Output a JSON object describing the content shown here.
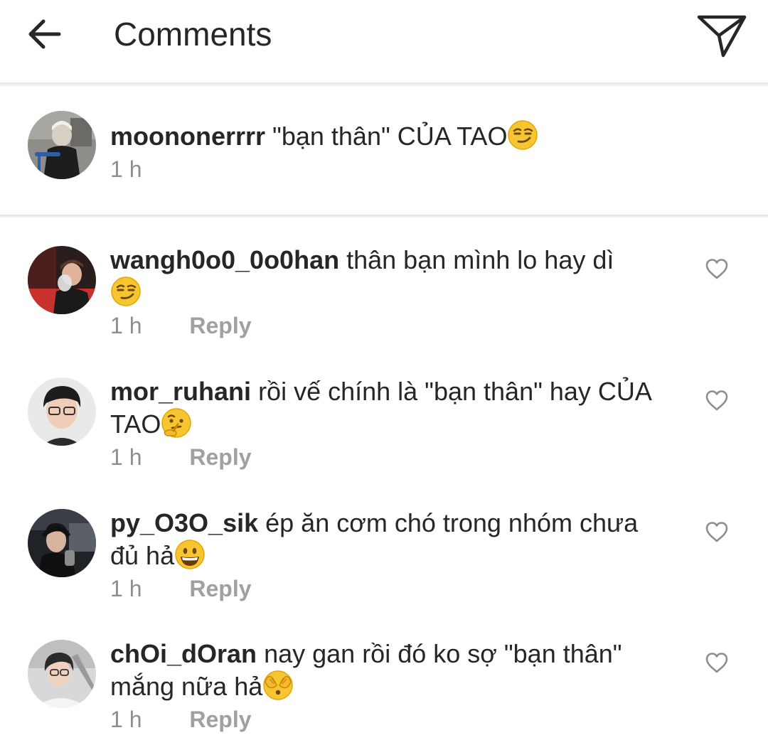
{
  "header": {
    "title": "Comments",
    "back_icon": "arrow-left-icon",
    "send_icon": "paper-plane-icon"
  },
  "caption": {
    "username": "moononerrrr",
    "text": "\"bạn thân\" CỦA TAO",
    "emoji": "smirk-emoji",
    "time": "1 h"
  },
  "comments": [
    {
      "username": "wangh0o0_0o0han",
      "text": "thân bạn mình lo hay dì",
      "emoji": "smirk-emoji",
      "time": "1 h",
      "reply_label": "Reply"
    },
    {
      "username": "mor_ruhani",
      "text": "rồi vế chính là \"bạn thân\" hay CỦA TAO",
      "emoji": "thinking-emoji",
      "time": "1 h",
      "reply_label": "Reply"
    },
    {
      "username": "py_O3O_sik",
      "text": "ép ăn cơm chó trong nhóm chưa đủ hả",
      "emoji": "grinning-emoji",
      "time": "1 h",
      "reply_label": "Reply"
    },
    {
      "username": "chOi_dOran",
      "text": "nay gan rồi đó ko sợ \"bạn thân\" mắng nữa hả",
      "emoji": "see-no-evil-emoji",
      "time": "1 h",
      "reply_label": "Reply"
    }
  ],
  "colors": {
    "text": "#262626",
    "secondary": "#8e8e8e",
    "divider": "#e6e6e6",
    "emoji_yellow": "#f7c531"
  }
}
